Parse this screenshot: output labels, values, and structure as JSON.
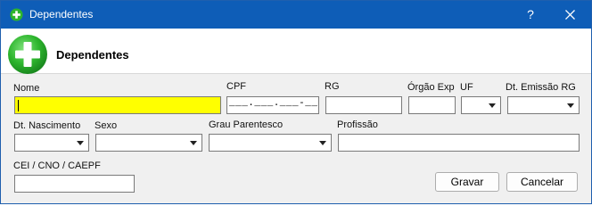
{
  "window": {
    "title": "Dependentes",
    "help_label": "?",
    "accent_color": "#0e5db7"
  },
  "header": {
    "title": "Dependentes",
    "icon": "green-plus-icon",
    "icon_color": "#2db52d"
  },
  "form": {
    "nome": {
      "label": "Nome",
      "value": ""
    },
    "cpf": {
      "label": "CPF",
      "mask": "___.___.___-__"
    },
    "rg": {
      "label": "RG",
      "value": ""
    },
    "orgao_exp": {
      "label": "Órgão Exp",
      "value": ""
    },
    "uf": {
      "label": "UF",
      "value": ""
    },
    "dt_emissao_rg": {
      "label": "Dt. Emissão RG",
      "value": ""
    },
    "dt_nascimento": {
      "label": "Dt. Nascimento",
      "value": ""
    },
    "sexo": {
      "label": "Sexo",
      "value": ""
    },
    "grau_parentesco": {
      "label": "Grau Parentesco",
      "value": ""
    },
    "profissao": {
      "label": "Profissão",
      "value": ""
    },
    "cei": {
      "label": "CEI / CNO / CAEPF",
      "value": ""
    }
  },
  "buttons": {
    "save": "Gravar",
    "cancel": "Cancelar"
  }
}
